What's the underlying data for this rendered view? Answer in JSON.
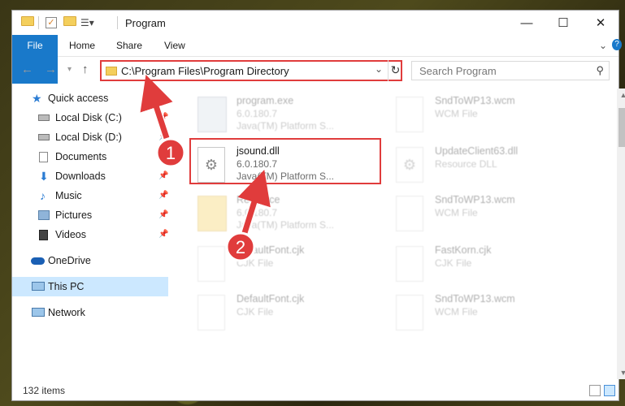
{
  "window": {
    "title": "Program"
  },
  "ribbon": {
    "tabs": [
      "File",
      "Home",
      "Share",
      "View"
    ]
  },
  "nav": {
    "address": "C:\\Program Files\\Program Directory",
    "search_placeholder": "Search Program"
  },
  "sidebar": {
    "items": [
      {
        "label": "Quick access",
        "icon": "star-icon"
      },
      {
        "label": "Local Disk (C:)",
        "icon": "drive-icon"
      },
      {
        "label": "Local Disk (D:)",
        "icon": "drive-icon"
      },
      {
        "label": "Documents",
        "icon": "documents-icon"
      },
      {
        "label": "Downloads",
        "icon": "download-icon"
      },
      {
        "label": "Music",
        "icon": "music-icon"
      },
      {
        "label": "Pictures",
        "icon": "pictures-icon"
      },
      {
        "label": "Videos",
        "icon": "videos-icon"
      },
      {
        "label": "OneDrive",
        "icon": "cloud-icon"
      },
      {
        "label": "This PC",
        "icon": "computer-icon"
      },
      {
        "label": "Network",
        "icon": "network-icon"
      }
    ]
  },
  "files": [
    {
      "name": "program.exe",
      "line1": "6.0.180.7",
      "line2": "Java(TM) Platform S..."
    },
    {
      "name": "SndToWP13.wcm",
      "line1": "WCM File",
      "line2": ""
    },
    {
      "name": "jsound.dll",
      "line1": "6.0.180.7",
      "line2": "Java(TM) Platform S..."
    },
    {
      "name": "UpdateClient63.dll",
      "line1": "Resource DLL",
      "line2": ""
    },
    {
      "name": "Resource",
      "line1": "6.0.180.7",
      "line2": "Java(TM) Platform S..."
    },
    {
      "name": "SndToWP13.wcm",
      "line1": "WCM File",
      "line2": ""
    },
    {
      "name": "DefaultFont.cjk",
      "line1": "CJK File",
      "line2": ""
    },
    {
      "name": "FastKorn.cjk",
      "line1": "CJK File",
      "line2": ""
    },
    {
      "name": "DefaultFont.cjk",
      "line1": "CJK File",
      "line2": ""
    },
    {
      "name": "SndToWP13.wcm",
      "line1": "WCM File",
      "line2": ""
    }
  ],
  "status": {
    "item_count": "132 items"
  },
  "annotations": [
    {
      "number": "1"
    },
    {
      "number": "2"
    }
  ],
  "colors": {
    "accent": "#1979ca",
    "highlight": "#e03c3c",
    "selected": "#cce8ff"
  }
}
